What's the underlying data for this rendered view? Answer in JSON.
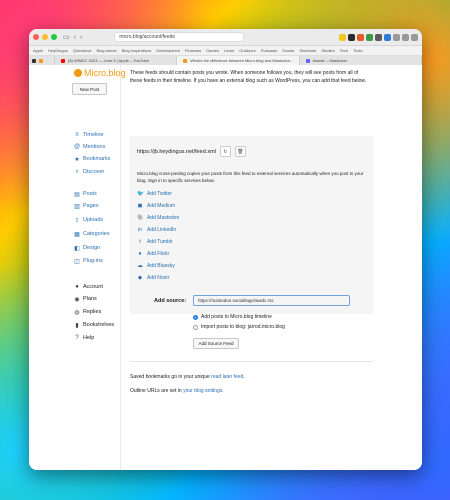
{
  "browser": {
    "url": "micro.blog/account/feeds",
    "bookmarks": [
      "Apple",
      "HeyDingus",
      "Quickdeck",
      "Blog Admin",
      "Blog Inspirations",
      "Development",
      "Finances",
      "Games",
      "Learn",
      "Outdoors",
      "Podcasts",
      "Scouts",
      "Shortcuts",
      "Studies",
      "Tech",
      "Tools"
    ],
    "tabs": [
      {
        "label": "(8) WWDC 2023 — June 5 | Apple – YouTube"
      },
      {
        "label": "What's the difference between Micro.blog and Mastodon..."
      },
      {
        "label": "#wwdc – Mastodon"
      }
    ]
  },
  "sidebar": {
    "logo": "Micro.blog",
    "new_post": "New Post",
    "nav": [
      {
        "label": "Timeline",
        "icon": "timeline-icon"
      },
      {
        "label": "Mentions",
        "icon": "at-icon"
      },
      {
        "label": "Bookmarks",
        "icon": "star-icon"
      },
      {
        "label": "Discover",
        "icon": "search-icon"
      },
      {
        "label": "Posts",
        "icon": "posts-icon"
      },
      {
        "label": "Pages",
        "icon": "pages-icon"
      },
      {
        "label": "Uploads",
        "icon": "upload-icon"
      },
      {
        "label": "Categories",
        "icon": "categories-icon"
      },
      {
        "label": "Design",
        "icon": "design-icon"
      },
      {
        "label": "Plug-ins",
        "icon": "plugins-icon"
      },
      {
        "label": "Account",
        "icon": "account-icon"
      },
      {
        "label": "Plans",
        "icon": "plans-icon"
      },
      {
        "label": "Replies",
        "icon": "replies-icon"
      },
      {
        "label": "Bookshelves",
        "icon": "book-icon"
      },
      {
        "label": "Help",
        "icon": "help-icon"
      }
    ]
  },
  "main": {
    "intro": "These feeds should contain posts you wrote. When someone follows you, they will see posts from all of these feeds in their timeline. If you have an external blog such as WordPress, you can add that feed below.",
    "feed_url": "https://jb.heydingus.net/feed.xml",
    "crosspost_text": "Micro.blog cross-posting copies your posts from this feed to external services automatically when you post to your blog. Sign in to specific services below.",
    "services": [
      {
        "label": "Add Twitter",
        "icon": "twitter-icon"
      },
      {
        "label": "Add Medium",
        "icon": "medium-icon"
      },
      {
        "label": "Add Mastodon",
        "icon": "mastodon-icon"
      },
      {
        "label": "Add LinkedIn",
        "icon": "linkedin-icon"
      },
      {
        "label": "Add Tumblr",
        "icon": "tumblr-icon"
      },
      {
        "label": "Add Flickr",
        "icon": "flickr-icon"
      },
      {
        "label": "Add Bluesky",
        "icon": "bluesky-icon"
      },
      {
        "label": "Add Nostr",
        "icon": "nostr-icon"
      }
    ],
    "add_source_label": "Add source:",
    "source_value": "https://mastodon.social/tags/wwdc.rss",
    "options": [
      {
        "label": "Add posts to Micro.blog timeline",
        "selected": true
      },
      {
        "label": "Import posts to blog: jarrod.micro.blog",
        "selected": false
      }
    ],
    "add_button": "Add Source Feed",
    "footer1_pre": "Saved bookmarks go in your unique ",
    "footer1_link": "read later feed",
    "footer1_post": ".",
    "footer2_pre": "Outline URLs are set in ",
    "footer2_link": "your blog settings",
    "footer2_post": "."
  }
}
